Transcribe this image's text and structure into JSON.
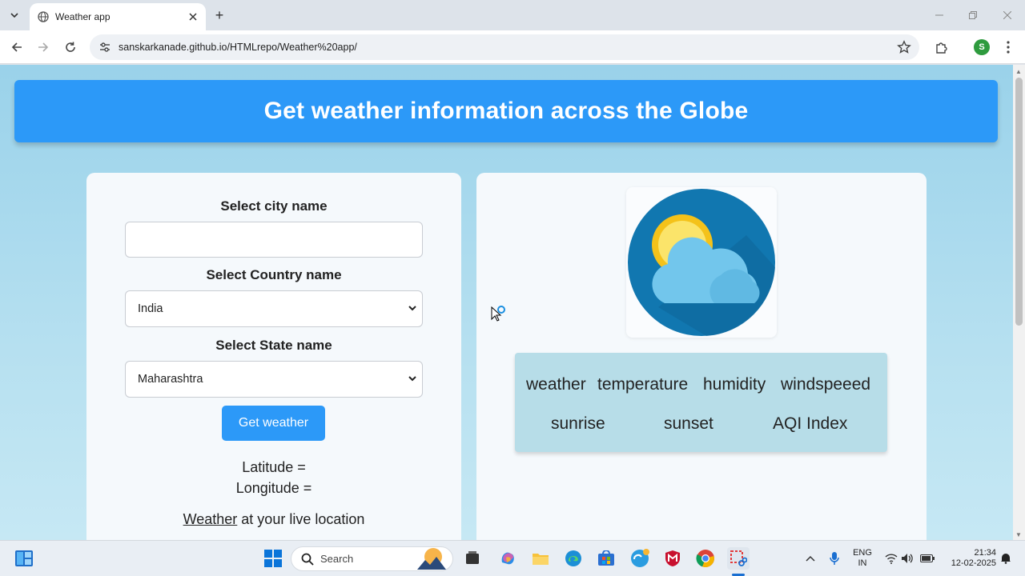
{
  "browser": {
    "tab_title": "Weather app",
    "new_tab_label": "+",
    "url": "sanskarkanade.github.io/HTMLrepo/Weather%20app/",
    "profile_initial": "S"
  },
  "page": {
    "banner_title": "Get weather information across the Globe",
    "form": {
      "city_label": "Select city name",
      "city_value": "",
      "country_label": "Select Country name",
      "country_selected": "India",
      "state_label": "Select State name",
      "state_selected": "Maharashtra",
      "button_label": "Get weather",
      "latitude_text": "Latitude =",
      "longitude_text": "Longitude =",
      "live_link": "Weather",
      "live_rest": " at your live location"
    },
    "info": {
      "weather": "weather",
      "temperature": "temperature",
      "humidity": "humidity",
      "windspeed": "windspeeed",
      "sunrise": "sunrise",
      "sunset": "sunset",
      "aqi": "AQI Index"
    }
  },
  "taskbar": {
    "search_placeholder": "Search",
    "lang_line1": "ENG",
    "lang_line2": "IN",
    "time": "21:34",
    "date": "12-02-2025"
  },
  "colors": {
    "accent": "#2c99f8",
    "info_panel": "#b7dde8"
  }
}
